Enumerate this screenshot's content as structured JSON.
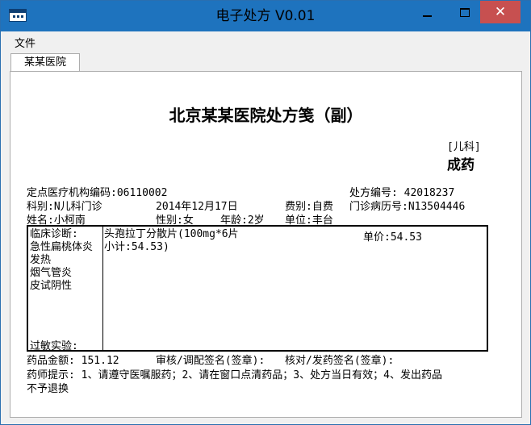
{
  "window": {
    "title": "电子处方 V0.01",
    "close_glyph": "✕"
  },
  "menu": {
    "file": "文件"
  },
  "tabs": [
    {
      "label": "某某医院"
    }
  ],
  "prescription": {
    "title": "北京某某医院处方笺（副）",
    "dept_tag": "[儿科]",
    "rx_type": "成药",
    "institution_code": "定点医疗机构编码:06110002",
    "rx_number": "处方编号: 42018237",
    "department": "科别:N儿科门诊",
    "date": "2014年12月17日",
    "fee_type": "费别:自费",
    "clinic_record": "门诊病历号:N13504446",
    "patient_name": "姓名:小柯南",
    "gender": "性别:女",
    "age": "年龄:2岁",
    "unit": "单位:丰台",
    "diagnosis_label": "临床诊断:",
    "diagnoses": [
      "急性扁桃体炎",
      "发热",
      "烟气管炎",
      "皮试阴性"
    ],
    "allergy_label": "过敏实验:",
    "drug_line": "头孢拉丁分散片(100mg*6片",
    "unit_price": "单价:54.53",
    "subtotal": "小计:54.53)",
    "total": "药品金额: 151.12",
    "review_sign": "审核/调配签名(签章):",
    "dispense_sign": "核对/发药签名(签章):",
    "note_line1": "药师提示: 1、请遵守医嘱服药；2、请在窗口点清药品；3、处方当日有效；4、发出药品",
    "note_line2": "不予退换"
  },
  "colors": {
    "titlebar": "#1e73be",
    "close_button": "#c75050"
  },
  "icons": {
    "app": "app-window-icon",
    "minimize": "minimize-icon",
    "maximize": "maximize-icon",
    "close": "close-icon"
  }
}
